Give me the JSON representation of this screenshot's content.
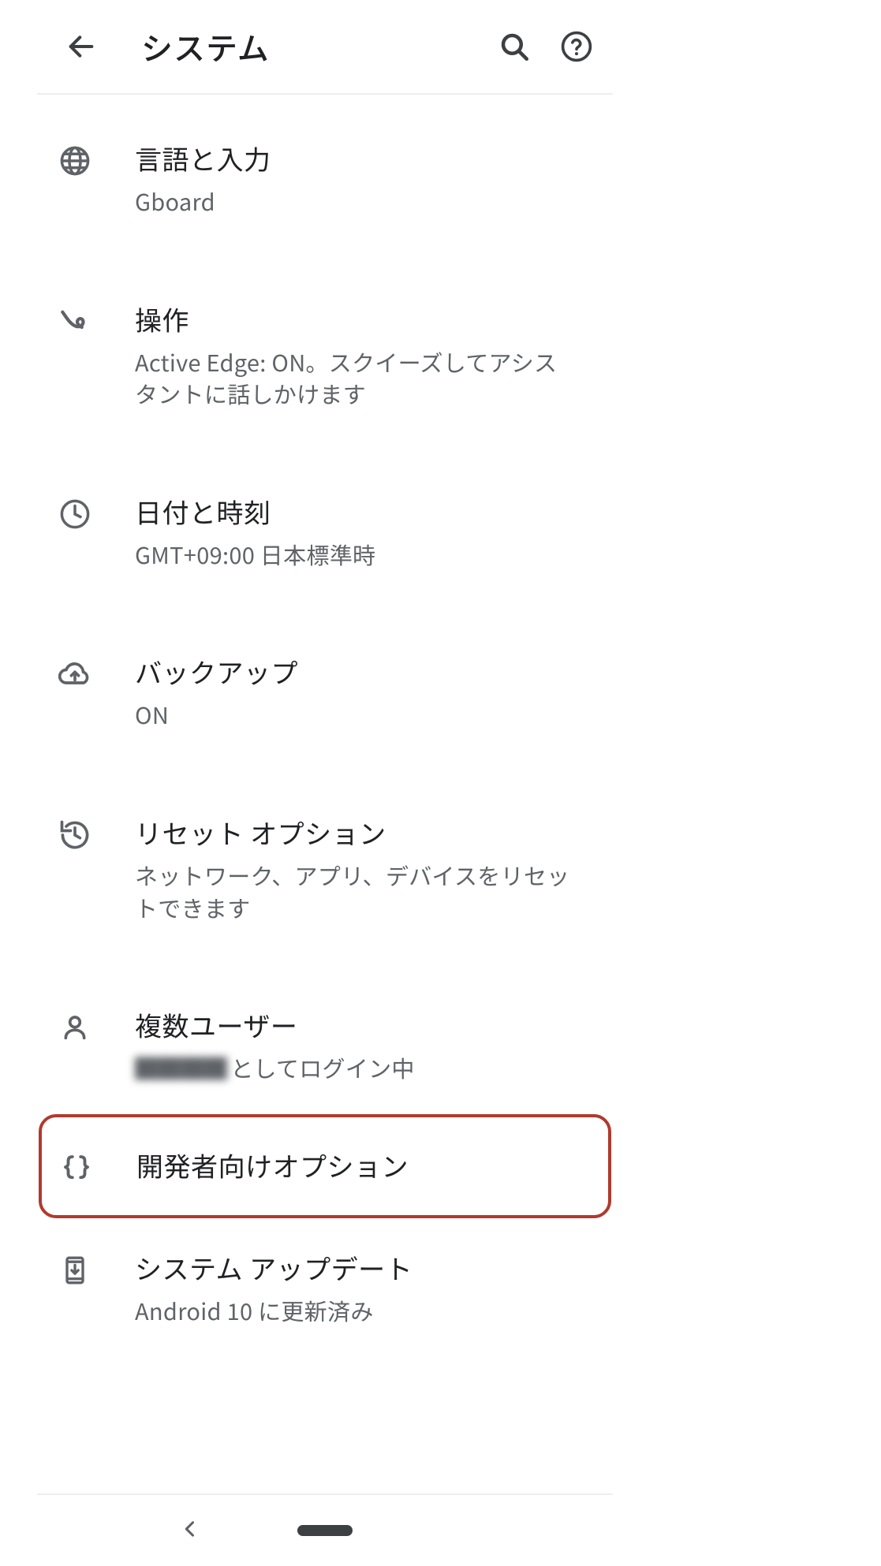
{
  "header": {
    "title": "システム"
  },
  "items": [
    {
      "title": "言語と入力",
      "subtitle": "Gboard"
    },
    {
      "title": "操作",
      "subtitle": "Active Edge: ON。スクイーズしてアシスタントに話しかけます"
    },
    {
      "title": "日付と時刻",
      "subtitle": "GMT+09:00 日本標準時"
    },
    {
      "title": "バックアップ",
      "subtitle": "ON"
    },
    {
      "title": "リセット オプション",
      "subtitle": "ネットワーク、アプリ、デバイスをリセットできます"
    },
    {
      "title": "複数ユーザー",
      "subtitle_suffix": "としてログイン中"
    },
    {
      "title": "開発者向けオプション"
    },
    {
      "title": "システム アップデート",
      "subtitle": "Android 10 に更新済み"
    }
  ],
  "highlight_color": "#b03a2e"
}
